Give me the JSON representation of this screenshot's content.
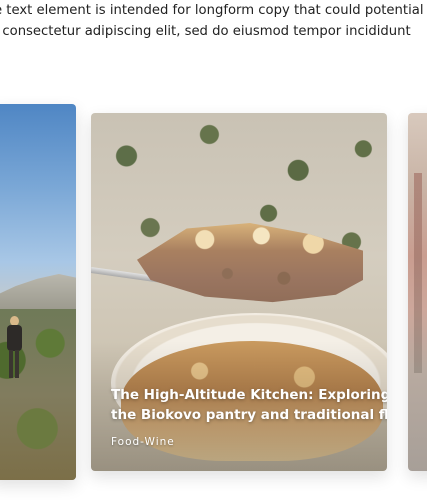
{
  "intro": {
    "line1": "e text element is intended for longform copy that could potential",
    "line2": ", consectetur adipiscing elit, sed do eiusmod tempor incididunt"
  },
  "cards": [
    {
      "image_alt": "hiker-landscape-photo"
    },
    {
      "title_line1": "The High-Altitude Kitchen: Exploring",
      "title_line2": "the Biokovo pantry and traditional flavors",
      "category": "Food-Wine",
      "image_alt": "pie-slice-photo"
    },
    {
      "image_alt": "textured-wall-photo"
    }
  ]
}
